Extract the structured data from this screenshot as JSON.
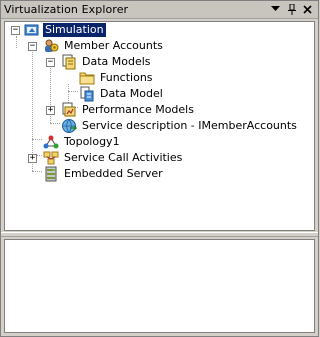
{
  "window": {
    "title": "Virtualization Explorer",
    "buttons": {
      "dropdown": "▼",
      "pin": "📌",
      "close": "✕"
    }
  },
  "tree": {
    "simulation": {
      "label": "Simulation",
      "selected": true,
      "expanded": true
    },
    "member_accounts": {
      "label": "Member Accounts",
      "expanded": true
    },
    "data_models": {
      "label": "Data Models",
      "expanded": true
    },
    "functions": {
      "label": "Functions"
    },
    "data_model": {
      "label": "Data Model"
    },
    "performance_models": {
      "label": "Performance Models",
      "expanded": false
    },
    "service_description": {
      "label": "Service description - IMemberAccounts"
    },
    "topology": {
      "label": "Topology1"
    },
    "service_call_activities": {
      "label": "Service Call Activities",
      "expanded": false
    },
    "embedded_server": {
      "label": "Embedded Server"
    }
  },
  "colors": {
    "selection": "#0a246a",
    "window_bg": "#d4d0c8"
  }
}
